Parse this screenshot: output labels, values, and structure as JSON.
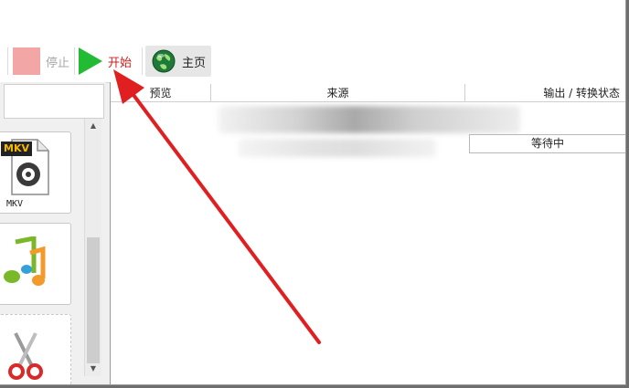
{
  "toolbar": {
    "stop_label": "停止",
    "start_label": "开始",
    "home_label": "主页"
  },
  "left_panel": {
    "tiles": [
      {
        "icon": "mkv-file-icon",
        "label": "MKV",
        "badge": "MKV"
      },
      {
        "icon": "music-notes-icon",
        "label": ""
      },
      {
        "icon": "scissors-icon",
        "label": ""
      }
    ]
  },
  "table": {
    "headers": [
      "预览",
      "来源",
      "输出 / 转换状态"
    ],
    "rows": [
      {
        "source": "",
        "status": "等待中"
      }
    ]
  },
  "colors": {
    "accent_red": "#e02020",
    "play_green": "#22bb33",
    "stop_pink": "#f3a6a6"
  }
}
